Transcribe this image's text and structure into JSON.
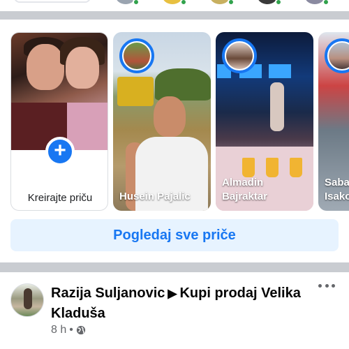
{
  "stories": {
    "create_label": "Kreirajte priču",
    "plus_glyph": "+",
    "items": [
      {
        "name": "Husein Pajalic"
      },
      {
        "name": "Almadin Bajraktar"
      },
      {
        "name": "Saba Isako"
      }
    ],
    "see_all_label": "Pogledaj sve priče"
  },
  "post": {
    "author": "Razija Suljanovic",
    "arrow_glyph": "▶",
    "group": "Kupi prodaj Velika Kladuša",
    "time": "8 h",
    "separator": "•",
    "privacy_icon": "globe-icon",
    "more_icon": "more-horizontal-icon"
  },
  "colors": {
    "accent": "#1877f2",
    "see_all_bg": "#e7f3ff",
    "divider": "#c9ccd1",
    "online": "#31a24c"
  }
}
